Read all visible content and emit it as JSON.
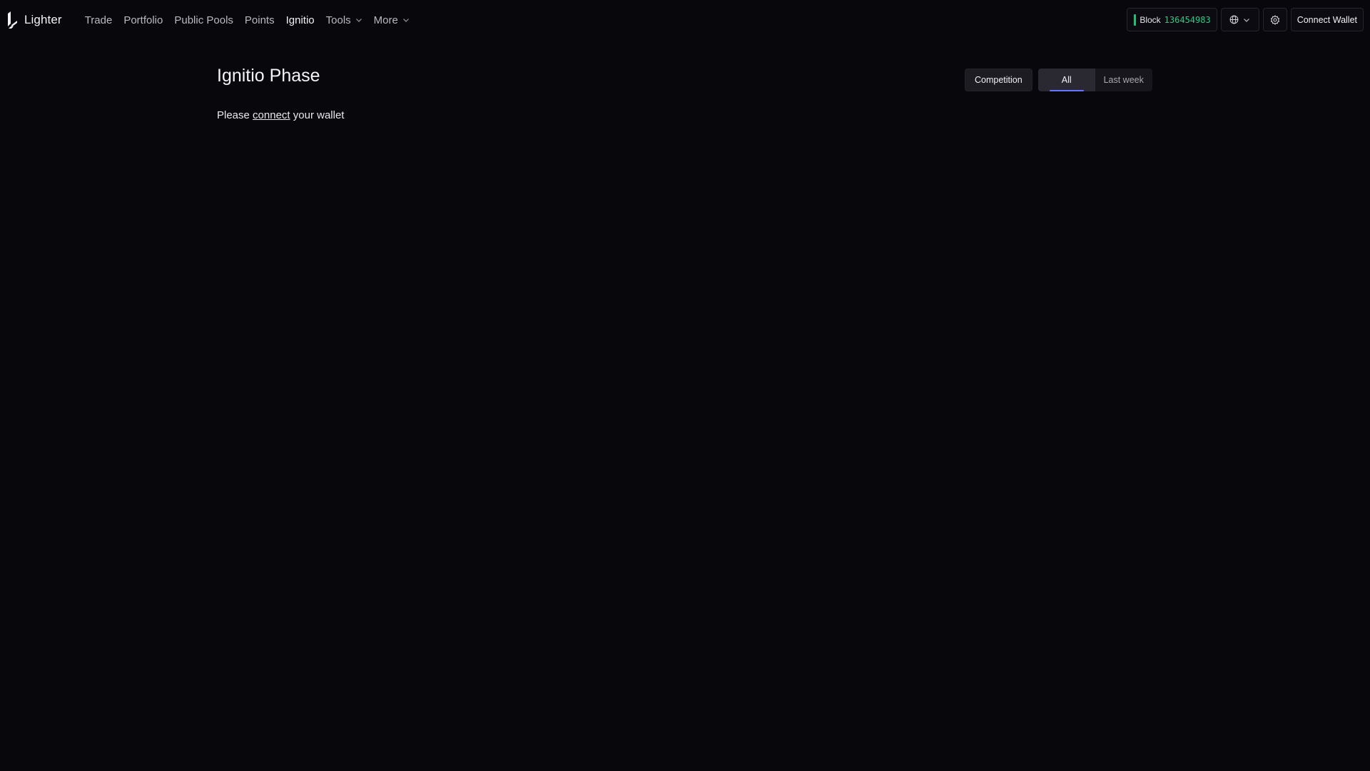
{
  "app": {
    "name": "Lighter"
  },
  "nav": {
    "items": [
      {
        "label": "Trade"
      },
      {
        "label": "Portfolio"
      },
      {
        "label": "Public Pools"
      },
      {
        "label": "Points"
      },
      {
        "label": "Ignitio",
        "active": true
      },
      {
        "label": "Tools",
        "dropdown": true
      },
      {
        "label": "More",
        "dropdown": true
      }
    ]
  },
  "header": {
    "block_label": "Block",
    "block_number": "136454983",
    "connect_wallet_label": "Connect Wallet",
    "icons": [
      "globe-icon",
      "chevron-down-icon",
      "settings-icon"
    ]
  },
  "main": {
    "title": "Ignitio Phase",
    "message_before": "Please",
    "message_link": "connect",
    "message_after": "your wallet",
    "competition_label": "Competition",
    "tabs": [
      {
        "label": "All",
        "active": true
      },
      {
        "label": "Last week",
        "active": false
      }
    ]
  },
  "colors": {
    "background": "#08070c",
    "block_status": "#19c37d",
    "tab_accent": "#5b7cff"
  }
}
